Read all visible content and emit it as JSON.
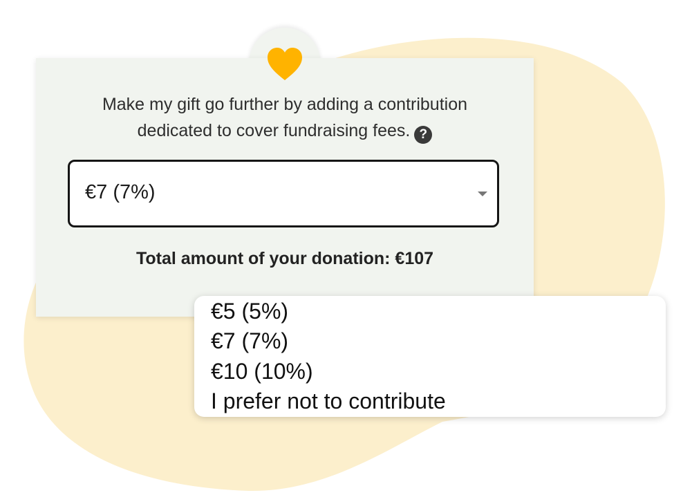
{
  "colors": {
    "blob": "#fcefcc",
    "card": "#f1f4ef",
    "heart": "#ffb300"
  },
  "heart_icon": "heart-icon",
  "description": {
    "line1": "Make my gift go further by adding a contribution",
    "line2": "dedicated to cover fundraising fees.",
    "help_icon_glyph": "?"
  },
  "select": {
    "value": "€7 (7%)",
    "caret_icon": "caret-down-icon"
  },
  "total": "Total amount of your donation: €107",
  "dropdown": {
    "options": [
      "€5 (5%)",
      "€7 (7%)",
      "€10 (10%)",
      "I prefer not to contribute"
    ]
  }
}
